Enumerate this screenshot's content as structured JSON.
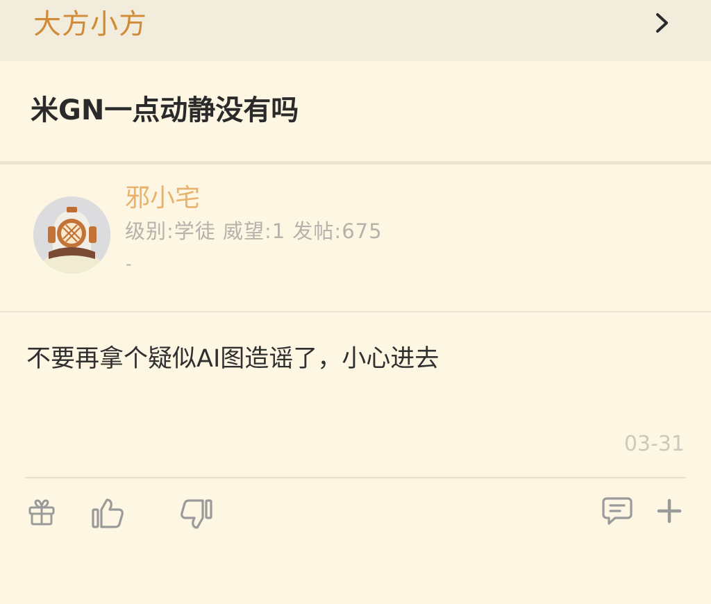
{
  "header": {
    "forum_name": "大方小方",
    "chevron_icon": "chevron-right-icon"
  },
  "post": {
    "title": "米GN一点动静没有吗",
    "content": "不要再拿个疑似AI图造谣了，小心进去",
    "date": "03-31"
  },
  "author": {
    "name": "邪小宅",
    "meta": "级别:学徒  威望:1  发帖:675",
    "signature": "-",
    "avatar_icon": "diving-helmet-avatar"
  },
  "actions": {
    "icons": [
      "gift-icon",
      "thumbs-up-icon",
      "thumbs-down-icon",
      "comment-icon",
      "plus-icon"
    ]
  },
  "colors": {
    "background": "#fcf6e2",
    "header_bg": "#f1ecdc",
    "forum_name": "#d18a35",
    "username": "#e9b36c",
    "muted": "#b5b2ab",
    "icon": "#9a9a9a"
  }
}
